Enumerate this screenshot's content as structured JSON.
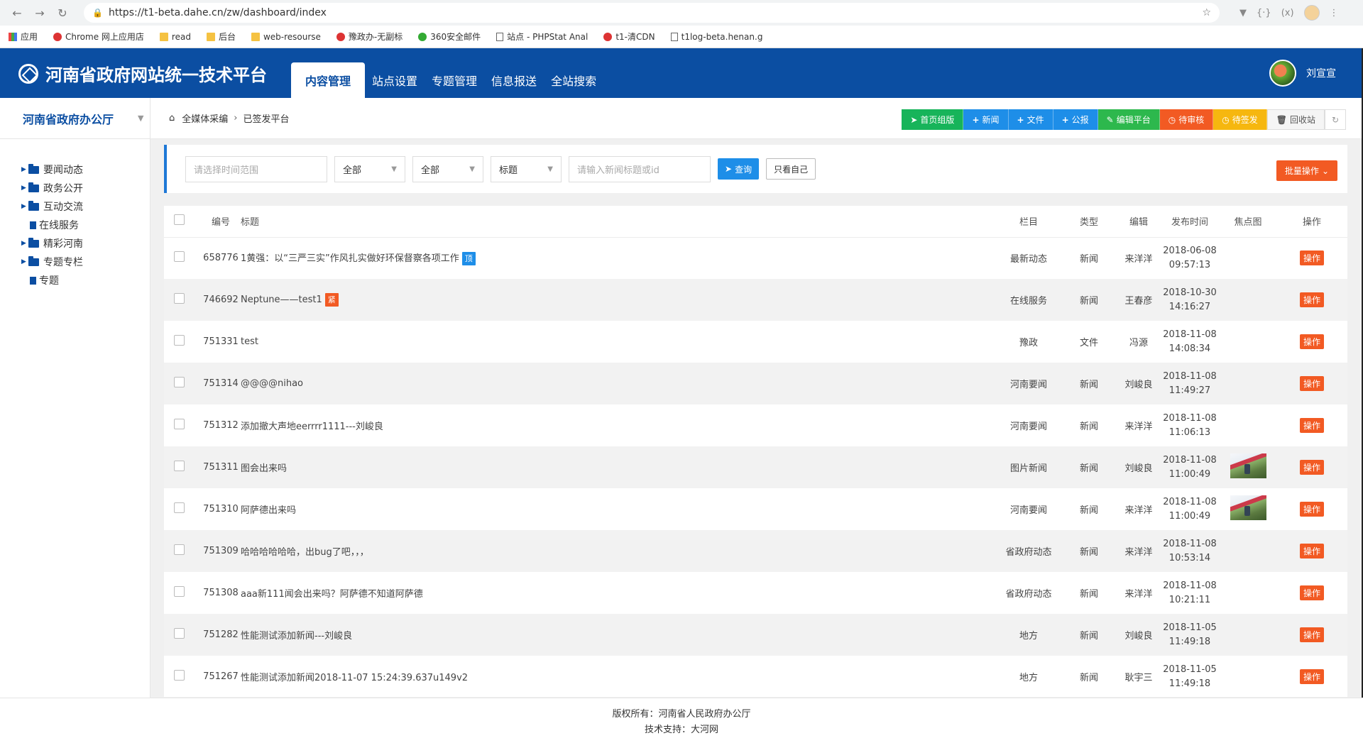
{
  "browser": {
    "url": "https://t1-beta.dahe.cn/zw/dashboard/index",
    "bookmarks": [
      "应用",
      "Chrome 网上应用店",
      "read",
      "后台",
      "web-resourse",
      "豫政办-无副标",
      "360安全邮件",
      "站点 - PHPStat Anal",
      "t1-清CDN",
      "t1log-beta.henan.g"
    ]
  },
  "header": {
    "logo_text": "河南省政府网站统一技术平台",
    "nav": [
      "内容管理",
      "站点设置",
      "专题管理",
      "信息报送",
      "全站搜索"
    ],
    "user_name": "刘宣宣"
  },
  "sidebar": {
    "title": "河南省政府办公厅",
    "items": [
      {
        "label": "要闻动态",
        "type": "folder"
      },
      {
        "label": "政务公开",
        "type": "folder"
      },
      {
        "label": "互动交流",
        "type": "folder"
      },
      {
        "label": "在线服务",
        "type": "file"
      },
      {
        "label": "精彩河南",
        "type": "folder"
      },
      {
        "label": "专题专栏",
        "type": "folder"
      },
      {
        "label": "专题",
        "type": "file"
      }
    ]
  },
  "breadcrumb": {
    "home": "全媒体采编",
    "current": "已签发平台"
  },
  "toolbar": {
    "buttons": [
      "首页组版",
      "新闻",
      "文件",
      "公报",
      "编辑平台",
      "待审核",
      "待签发",
      "回收站"
    ]
  },
  "filters": {
    "date_placeholder": "请选择时间范围",
    "select1": "全部",
    "select2": "全部",
    "select3": "标题",
    "keyword_placeholder": "请输入新闻标题或id",
    "search_label": "查询",
    "self_label": "只看自己",
    "batch_label": "批量操作"
  },
  "table": {
    "headers": {
      "id": "编号",
      "title": "标题",
      "column": "栏目",
      "type": "类型",
      "editor": "编辑",
      "time": "发布时间",
      "focus": "焦点图",
      "op": "操作"
    },
    "op_label": "操作",
    "rows": [
      {
        "id": "658776",
        "title": "1黄强：以“三严三实”作风扎实做好环保督察各项工作",
        "tag": "顶",
        "column": "最新动态",
        "type": "新闻",
        "editor": "来洋洋",
        "date": "2018-06-08",
        "clock": "09:57:13"
      },
      {
        "id": "746692",
        "title": "Neptune——test1",
        "tag": "紧",
        "column": "在线服务",
        "type": "新闻",
        "editor": "王春彦",
        "date": "2018-10-30",
        "clock": "14:16:27"
      },
      {
        "id": "751331",
        "title": "test",
        "tag": "",
        "column": "豫政",
        "type": "文件",
        "editor": "冯源",
        "date": "2018-11-08",
        "clock": "14:08:34"
      },
      {
        "id": "751314",
        "title": "@@@@nihao",
        "tag": "",
        "column": "河南要闻",
        "type": "新闻",
        "editor": "刘峻良",
        "date": "2018-11-08",
        "clock": "11:49:27"
      },
      {
        "id": "751312",
        "title": "添加撤大声地eerrrr1111---刘峻良",
        "tag": "",
        "column": "河南要闻",
        "type": "新闻",
        "editor": "来洋洋",
        "date": "2018-11-08",
        "clock": "11:06:13"
      },
      {
        "id": "751311",
        "title": "图会出来吗",
        "tag": "",
        "column": "图片新闻",
        "type": "新闻",
        "editor": "刘峻良",
        "date": "2018-11-08",
        "clock": "11:00:49",
        "thumb": true
      },
      {
        "id": "751310",
        "title": "阿萨德出来吗",
        "tag": "",
        "column": "河南要闻",
        "type": "新闻",
        "editor": "来洋洋",
        "date": "2018-11-08",
        "clock": "11:00:49",
        "thumb": true
      },
      {
        "id": "751309",
        "title": "哈哈哈哈哈哈，出bug了吧，，，",
        "tag": "",
        "column": "省政府动态",
        "type": "新闻",
        "editor": "来洋洋",
        "date": "2018-11-08",
        "clock": "10:53:14"
      },
      {
        "id": "751308",
        "title": "aaa新111闻会出来吗？阿萨德不知道阿萨德",
        "tag": "",
        "column": "省政府动态",
        "type": "新闻",
        "editor": "来洋洋",
        "date": "2018-11-08",
        "clock": "10:21:11"
      },
      {
        "id": "751282",
        "title": "性能测试添加新闻---刘峻良",
        "tag": "",
        "column": "地方",
        "type": "新闻",
        "editor": "刘峻良",
        "date": "2018-11-05",
        "clock": "11:49:18"
      },
      {
        "id": "751267",
        "title": "性能测试添加新闻2018-11-07 15:24:39.637u149v2",
        "tag": "",
        "column": "地方",
        "type": "新闻",
        "editor": "耿宇三",
        "date": "2018-11-05",
        "clock": "11:49:18"
      }
    ]
  },
  "footer": {
    "copyright": "版权所有：河南省人民政府办公厅",
    "support": "技术支持：大河网"
  }
}
